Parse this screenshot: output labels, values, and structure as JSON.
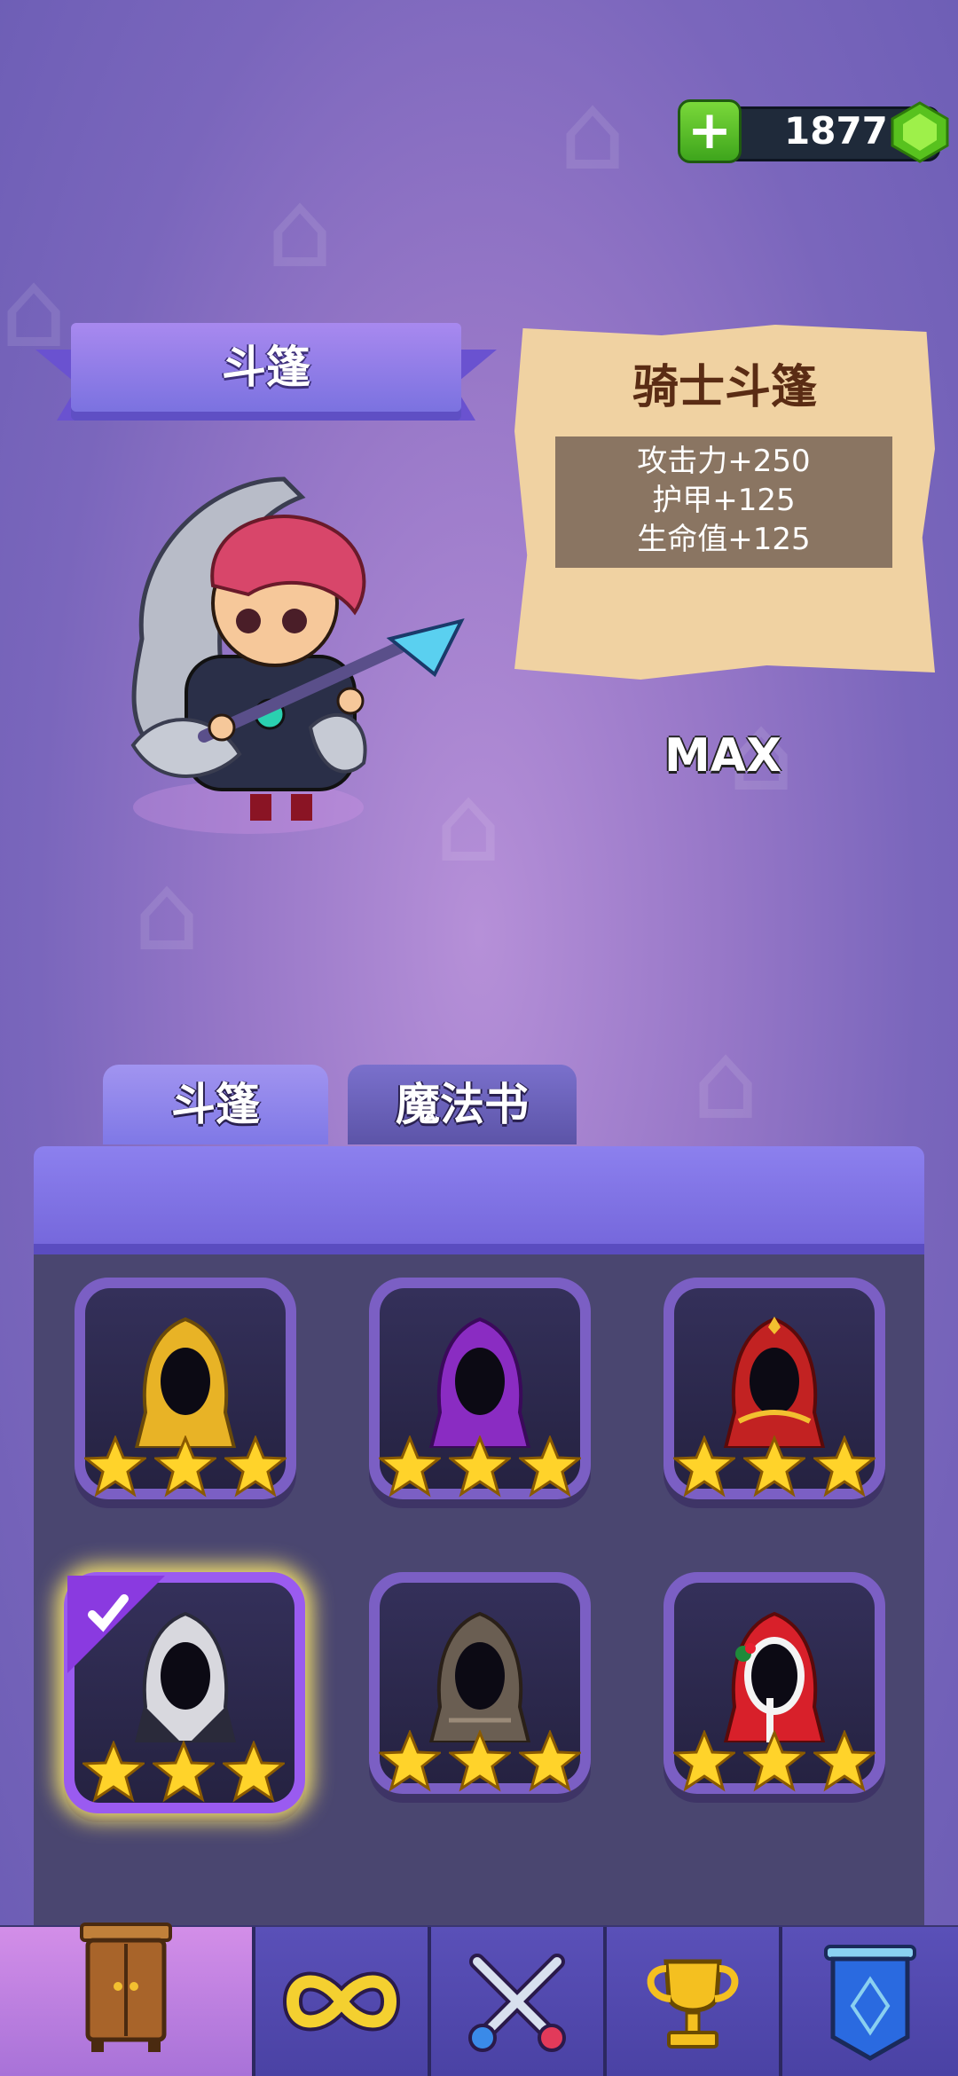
{
  "currency": {
    "amount": "1877",
    "plus_icon": "plus-icon",
    "gem_icon": "green-gem-icon"
  },
  "banner": {
    "title": "斗篷"
  },
  "item_info": {
    "name": "骑士斗篷",
    "stats": [
      "攻击力+250",
      "护甲+125",
      "生命值+125"
    ],
    "level": "MAX"
  },
  "tabs": [
    {
      "label": "斗篷",
      "active": true
    },
    {
      "label": "魔法书",
      "active": false
    }
  ],
  "cloaks": [
    {
      "icon": "yellow-cloak-icon",
      "color": "#e8b326",
      "stars": 3,
      "selected": false
    },
    {
      "icon": "purple-cloak-icon",
      "color": "#8a2cc2",
      "stars": 3,
      "selected": false
    },
    {
      "icon": "red-cloak-icon",
      "color": "#c22222",
      "stars": 3,
      "selected": false
    },
    {
      "icon": "knight-cloak-icon",
      "color": "#d8d8de",
      "stars": 3,
      "selected": true
    },
    {
      "icon": "brown-cloak-icon",
      "color": "#6a5e52",
      "stars": 3,
      "selected": false
    },
    {
      "icon": "christmas-cloak-icon",
      "color": "#d8202a",
      "stars": 3,
      "selected": false
    }
  ],
  "nav": [
    {
      "icon": "wardrobe-icon",
      "active": true
    },
    {
      "icon": "infinity-icon",
      "active": false
    },
    {
      "icon": "crossed-swords-icon",
      "active": false
    },
    {
      "icon": "trophy-icon",
      "active": false
    },
    {
      "icon": "shield-banner-icon",
      "active": false
    }
  ]
}
